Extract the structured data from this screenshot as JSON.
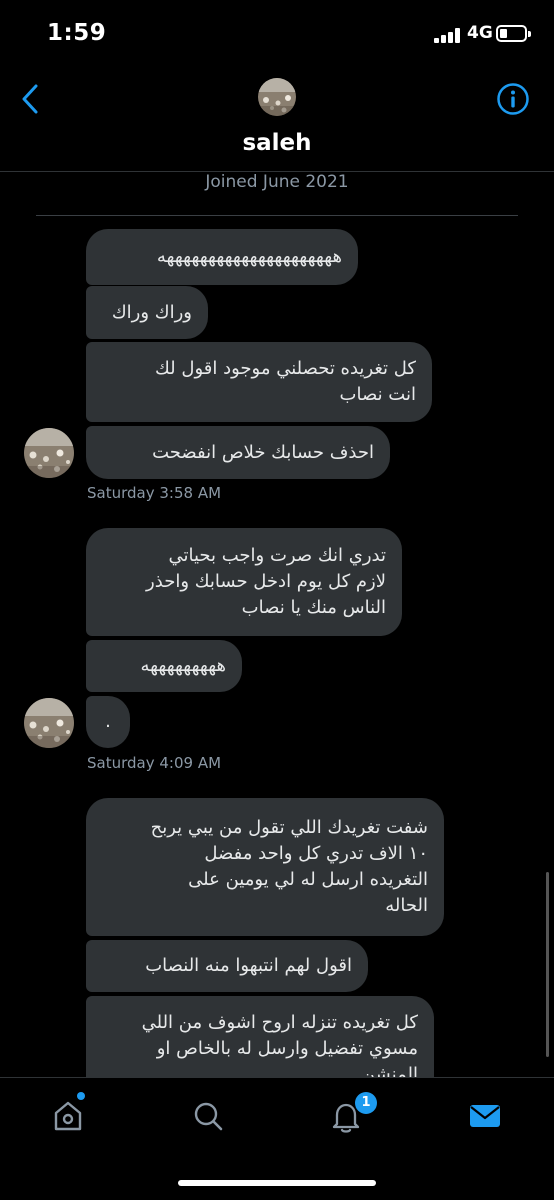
{
  "status_bar": {
    "time": "1:59",
    "network": "4G"
  },
  "header": {
    "name": "saleh"
  },
  "conversation": {
    "joined": "Joined June 2021",
    "messages": [
      "هههههههههههههههههههههه",
      "وراك وراك",
      "كل تغريده تحصلني موجود اقول لك\nانت نصاب",
      "احذف حسابك خلاص انفضحت",
      "تدري انك صرت واجب بحياتي\nلازم كل يوم ادخل حسابك واحذر\nالناس منك يا نصاب",
      "هههههههههه",
      ".",
      "شفت تغريدك اللي تقول من يبي يربح\n١٠ الاف تدري كل واحد مفضل\nالتغريده ارسل له لي يومين على\nالحاله",
      "اقول لهم انتبهوا منه النصاب",
      "كل تغريده تنزله اروح اشوف من اللي\nمسوي تفضيل وارسل له بالخاص او\nالمنشن"
    ],
    "timestamps": [
      "Saturday 3:58 AM",
      "Saturday 4:09 AM"
    ]
  },
  "tabbar": {
    "notifications_badge": "1"
  },
  "colors": {
    "accent": "#1d9bf0",
    "bubble": "#2f3336",
    "muted": "#8b98a5"
  }
}
